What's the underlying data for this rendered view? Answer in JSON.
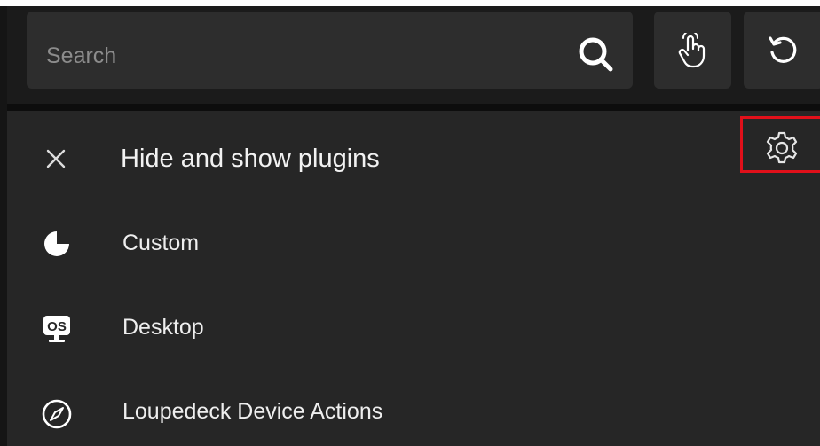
{
  "search": {
    "placeholder": "Search"
  },
  "panel": {
    "title": "Hide and show plugins",
    "plugins": [
      {
        "label": "Custom",
        "icon": "custom-pie-icon"
      },
      {
        "label": "Desktop",
        "icon": "os-desktop-icon"
      },
      {
        "label": "Loupedeck Device Actions",
        "icon": "compass-icon"
      }
    ]
  },
  "colors": {
    "highlight": "#e0101a",
    "background": "#262626",
    "text": "#eeeeee"
  }
}
